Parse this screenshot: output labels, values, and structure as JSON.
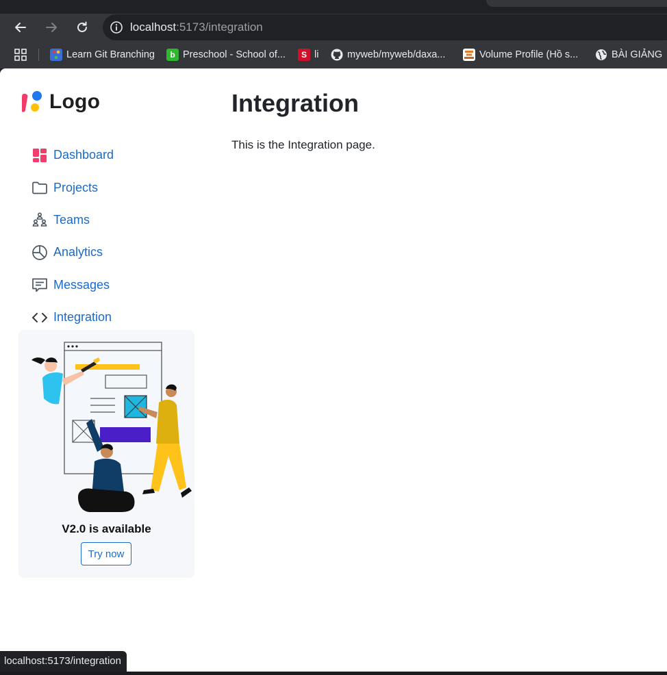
{
  "browser": {
    "url_host": "localhost",
    "url_path": ":5173/integration",
    "bookmarks": [
      {
        "label": "Learn Git Branching",
        "icon": "git-branch-icon",
        "color": "#3b6ed9"
      },
      {
        "label": "Preschool - School of...",
        "icon": "preschool-favicon",
        "color": "#2eb82e",
        "letter": "b"
      },
      {
        "label": "li",
        "icon": "scribd-favicon",
        "color": "#d0112b",
        "letter": "S"
      },
      {
        "label": "myweb/myweb/daxa...",
        "icon": "github-icon"
      },
      {
        "label": "Volume Profile (Hồ s...",
        "icon": "volume-profile-favicon",
        "color": "#e37b2b"
      },
      {
        "label": "BÀI GIẢNG",
        "icon": "globe-icon"
      }
    ],
    "status_url": "localhost:5173/integration"
  },
  "sidebar": {
    "logo_text": "Logo",
    "items": [
      {
        "label": "Dashboard",
        "icon": "dashboard-icon"
      },
      {
        "label": "Projects",
        "icon": "folder-icon"
      },
      {
        "label": "Teams",
        "icon": "teams-icon"
      },
      {
        "label": "Analytics",
        "icon": "pie-chart-icon"
      },
      {
        "label": "Messages",
        "icon": "message-icon"
      },
      {
        "label": "Integration",
        "icon": "code-icon"
      }
    ],
    "promo": {
      "title": "V2.0 is available",
      "button_label": "Try now"
    }
  },
  "main": {
    "title": "Integration",
    "text": "This is the Integration page."
  },
  "colors": {
    "link": "#1a6bc9",
    "chrome_dark": "#202124",
    "chrome_toolbar": "#35363a",
    "logo_pink": "#f23d6b",
    "logo_blue": "#1e78f0",
    "logo_yellow": "#ffc107"
  }
}
